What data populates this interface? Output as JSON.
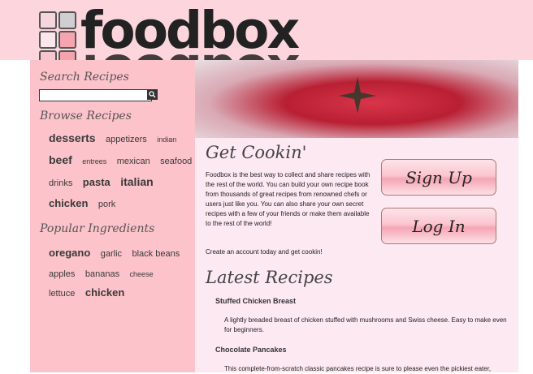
{
  "header": {
    "logo_text": "foodbox",
    "logo_squares": [
      "#f6d6dc",
      "#cfcfd3",
      "#fbe6ec",
      "#f4a5b0",
      "#f6c6cf",
      "#f3a3ae"
    ]
  },
  "sidebar": {
    "search_heading": "Search Recipes",
    "search_placeholder": "",
    "browse_heading": "Browse Recipes",
    "browse_tags": [
      [
        "desserts",
        "appetizers",
        "indian"
      ],
      [
        "beef",
        "entrees",
        "mexican",
        "seafood"
      ],
      [
        "drinks",
        "pasta",
        "italian"
      ],
      [
        "chicken",
        "pork"
      ]
    ],
    "popular_heading": "Popular Ingredients",
    "popular_tags": [
      [
        "oregano",
        "garlic",
        "black beans"
      ],
      [
        "apples",
        "bananas",
        "cheese"
      ],
      [
        "lettuce",
        "chicken"
      ]
    ]
  },
  "main": {
    "title": "Get Cookin'",
    "intro": "Foodbox is the best way to collect and share recipes with the rest of the world. You can build your own recipe book from thousands of great recipes from renowned chefs or users just like you. You can also share your own secret recipes with a few of your friends or make them available to the rest of the world!",
    "cta_text": "Create an account today and get cookin!",
    "signup_label": "Sign Up",
    "login_label": "Log In",
    "latest_heading": "Latest Recipes",
    "recipes": [
      {
        "title": "Stuffed Chicken Breast",
        "description": "A lightly breaded breast of chicken stuffed with mushrooms and Swiss cheese. Easy to make even for beginners."
      },
      {
        "title": "Chocolate Pancakes",
        "description": "This complete-from-scratch classic pancakes recipe is sure to please even the pickiest eater,"
      }
    ]
  },
  "colors": {
    "header_bg": "#fcd6dc",
    "sidebar_bg": "#fcc3ca",
    "main_bg": "#fde9f1"
  }
}
